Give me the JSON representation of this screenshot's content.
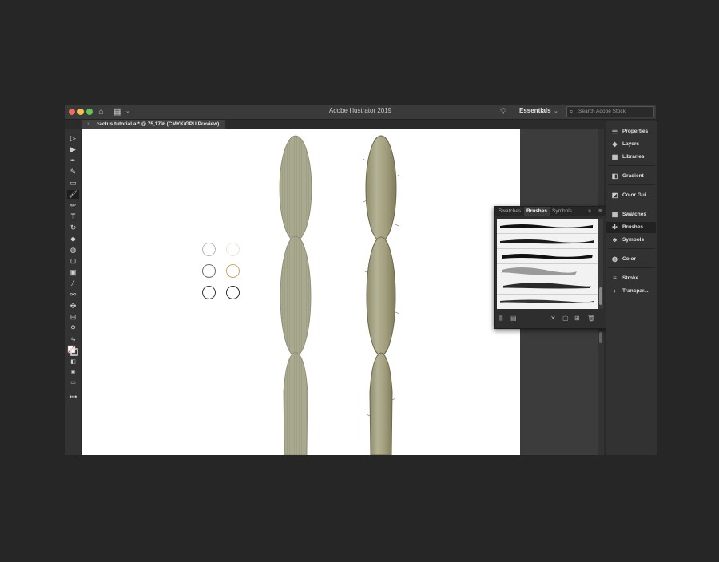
{
  "window": {
    "app_title": "Adobe Illustrator 2019",
    "workspace": "Essentials",
    "search_placeholder": "Search Adobe Stock"
  },
  "document_tab": {
    "close_glyph": "×",
    "title": "cactus tutorial.ai* @ 75,17% (CMYK/GPU Preview)"
  },
  "tools": [
    "selection-tool",
    "direct-selection-tool",
    "pen-tool",
    "curvature-tool",
    "rectangle-tool",
    "paintbrush-tool",
    "shaper-tool",
    "type-tool",
    "rotate-tool",
    "eraser-tool",
    "warp-tool",
    "free-transform-tool",
    "gradient-tool",
    "eyedropper-tool",
    "blend-tool",
    "symbol-sprayer-tool",
    "artboard-tool",
    "zoom-tool",
    "swap-colors",
    "fill-stroke",
    "color-modes",
    "draw-modes",
    "screen-mode",
    "edit-toolbar"
  ],
  "right_panel": {
    "items": [
      {
        "label": "Properties",
        "icon": "properties-icon"
      },
      {
        "label": "Layers",
        "icon": "layers-icon"
      },
      {
        "label": "Libraries",
        "icon": "libraries-icon"
      },
      {
        "label": "Gradient",
        "icon": "gradient-icon"
      },
      {
        "label": "Color Gui...",
        "icon": "color-guide-icon"
      },
      {
        "label": "Swatches",
        "icon": "swatches-icon"
      },
      {
        "label": "Brushes",
        "icon": "brushes-icon"
      },
      {
        "label": "Symbols",
        "icon": "symbols-icon"
      },
      {
        "label": "Color",
        "icon": "color-icon"
      },
      {
        "label": "Stroke",
        "icon": "stroke-icon"
      },
      {
        "label": "Transpar...",
        "icon": "transparency-icon"
      }
    ]
  },
  "brushes_panel": {
    "tabs": [
      "Swatches",
      "Brushes",
      "Symbols"
    ],
    "active_tab": "Brushes",
    "collapse_glyph": "»",
    "menu_glyph": "≡",
    "brush_count": 6
  },
  "colors": {
    "swatch_circles": [
      "#b8b8b8",
      "#e8e6de",
      "#6f6f62",
      "#c9a772",
      "#3a3a33",
      "#2c2c2c"
    ],
    "cactus_green": "#a8a88f",
    "cactus_textured": "#9a9a78"
  }
}
